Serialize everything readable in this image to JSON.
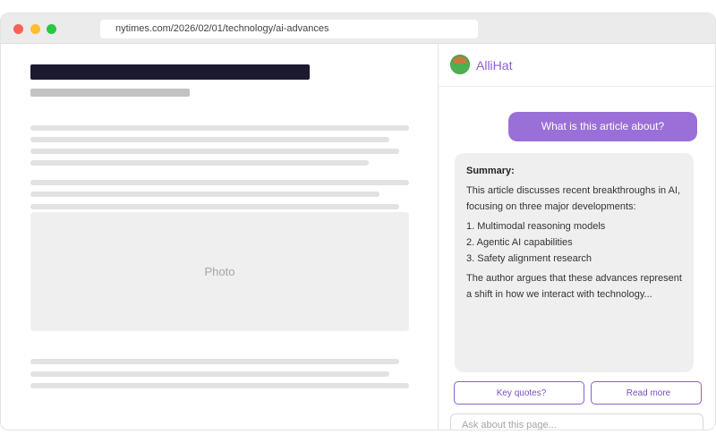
{
  "browser": {
    "url": "nytimes.com/2026/02/01/technology/ai-advances"
  },
  "article": {
    "photo_label": "Photo"
  },
  "panel": {
    "brand": "AlliHat",
    "user_message": "What is this article about?",
    "answer": {
      "heading": "Summary:",
      "intro": "This article discusses recent breakthroughs in AI, focusing on three major developments:",
      "items": [
        "1. Multimodal reasoning models",
        "2. Agentic AI capabilities",
        "3. Safety alignment research"
      ],
      "conclusion": "The author argues that these advances represent a shift in how we interact with technology..."
    },
    "suggestions": [
      "Key quotes?",
      "Read more"
    ],
    "input_placeholder": "Ask about this page..."
  },
  "colors": {
    "accent": "#9b6fd8",
    "brand_text": "#8a5fd0",
    "headline_block": "#1c1a2e"
  }
}
